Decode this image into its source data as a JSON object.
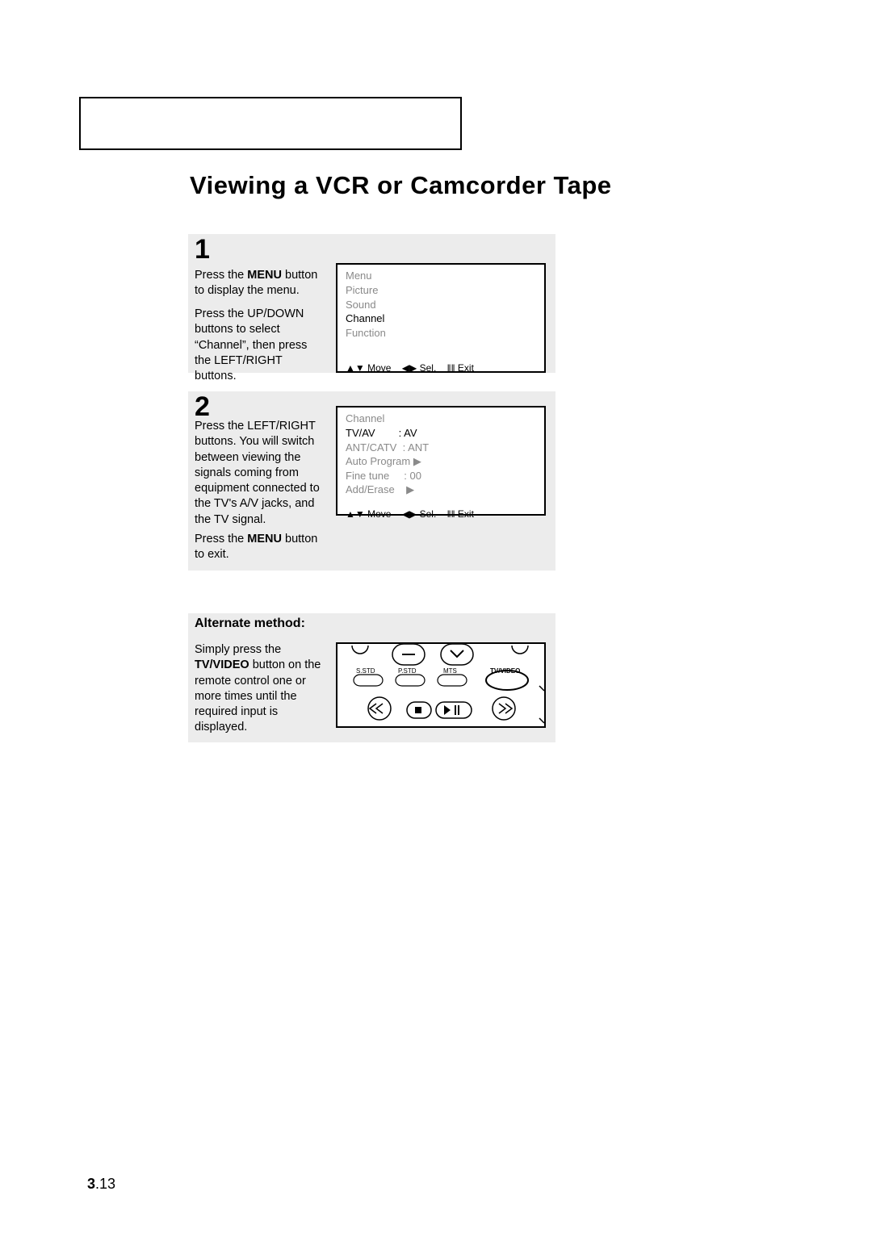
{
  "title": "Viewing a VCR or Camcorder Tape",
  "step1": {
    "num": "1",
    "para1_a": "Press the ",
    "para1_b": "MENU",
    "para1_c": " button to display the menu.",
    "para2": "Press the UP/DOWN buttons to select “Channel”, then press the LEFT/RIGHT      buttons.",
    "screen": {
      "head": "Menu",
      "r1": "Picture",
      "r2": "Sound",
      "r3": "Channel",
      "r4": "Function",
      "foot_move": "Move",
      "foot_sel": "Sel.",
      "foot_exit": "Exit"
    }
  },
  "step2": {
    "num": "2",
    "para1": "Press the LEFT/RIGHT buttons. You will switch between viewing the signals coming from equipment connected to the TV's A/V jacks, and the TV signal.",
    "para2_a": "Press the ",
    "para2_b": "MENU",
    "para2_c": " button to exit.",
    "screen": {
      "head": "Channel",
      "r1l": "TV/AV",
      "r1v": ": AV",
      "r2l": "ANT/CATV",
      "r2v": ": ANT",
      "r3l": "Auto Program",
      "r3v": "▶",
      "r4l": "Fine tune",
      "r4v": ": 00",
      "r5l": "Add/Erase",
      "r5v": "▶",
      "foot_move": "Move",
      "foot_sel": "Sel.",
      "foot_exit": "Exit"
    }
  },
  "alt": {
    "heading": "Alternate method:",
    "para_a": "Simply press the ",
    "para_b": "TV/VIDEO",
    "para_c": " button on the remote control one or more times until the required input is displayed.",
    "btn1": "S.STD",
    "btn2": "P.STD",
    "btn3": "MTS",
    "btn4": "TV/VIDEO"
  },
  "pagenum_bold": "3",
  "pagenum_rest": ".13",
  "sym_updown": "▲▼",
  "sym_leftright": "◀▶",
  "sym_menu": "‖‖"
}
